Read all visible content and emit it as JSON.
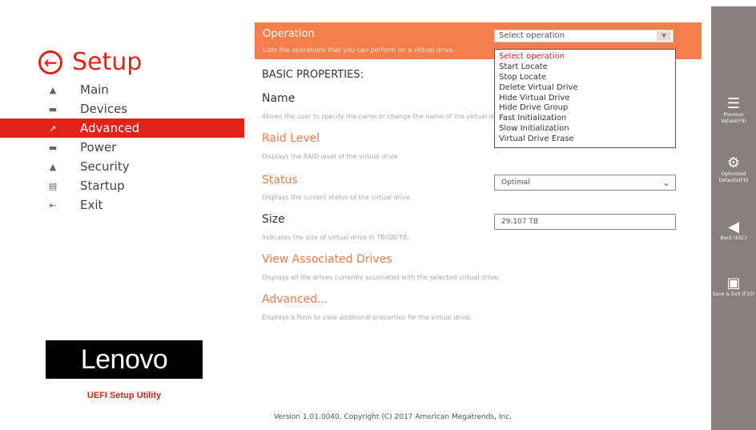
{
  "sidebar": {
    "title": "Setup",
    "items": [
      {
        "label": "Main",
        "icon": "home-icon"
      },
      {
        "label": "Devices",
        "icon": "devices-icon"
      },
      {
        "label": "Advanced",
        "icon": "advanced-icon",
        "active": true
      },
      {
        "label": "Power",
        "icon": "power-icon"
      },
      {
        "label": "Security",
        "icon": "lock-icon"
      },
      {
        "label": "Startup",
        "icon": "startup-icon"
      },
      {
        "label": "Exit",
        "icon": "exit-icon"
      }
    ],
    "logo": "Lenovo",
    "subtitle": "UEFI Setup Utility"
  },
  "operation": {
    "label": "Operation",
    "description": "Lists the operations that you can perform on a virtual drive.",
    "selected": "Select operation",
    "options": [
      "Select operation",
      "Start Locate",
      "Stop Locate",
      "Delete Virtual Drive",
      "Hide Virtual Drive",
      "Hide Drive Group",
      "Fast Initialization",
      "Slow Initialization",
      "Virtual Drive Erase"
    ]
  },
  "basic_properties": {
    "heading": "BASIC PROPERTIES:",
    "name_label": "Name",
    "name_desc": "Allows the user to specify the name or change the name of the virtual drive.",
    "raid_label": "Raid Level",
    "raid_desc": "Displays the RAID level of the virtual drive.",
    "status_label": "Status",
    "status_desc": "Displays the current status of the virtual drive.",
    "status_value": "Optimal",
    "size_label": "Size",
    "size_desc": "Indicates the size of virtual drive in TB/GB/TB.",
    "size_value": "29.107 TB"
  },
  "links": {
    "view_drives": "View Associated Drives",
    "view_drives_desc": "Displays all the drives currently associated with the selected virtual drive.",
    "advanced": "Advanced...",
    "advanced_desc": "Displays a form to view additional properties for the virtual drive."
  },
  "footer": {
    "version": "Version 1.01.0040. Copyright (C) 2017 American Megatrends, Inc."
  },
  "rightbar": {
    "previous_values": "Previous Values(F9)",
    "optimized_defaults": "Optimized Defaults(F9)",
    "back": "Back (ESC)",
    "save_exit": "Save & Exit (F10)"
  },
  "colors": {
    "accent": "#e2231a",
    "operation_bar": "#f47f4a",
    "rightbar": "#8a7f7f"
  }
}
